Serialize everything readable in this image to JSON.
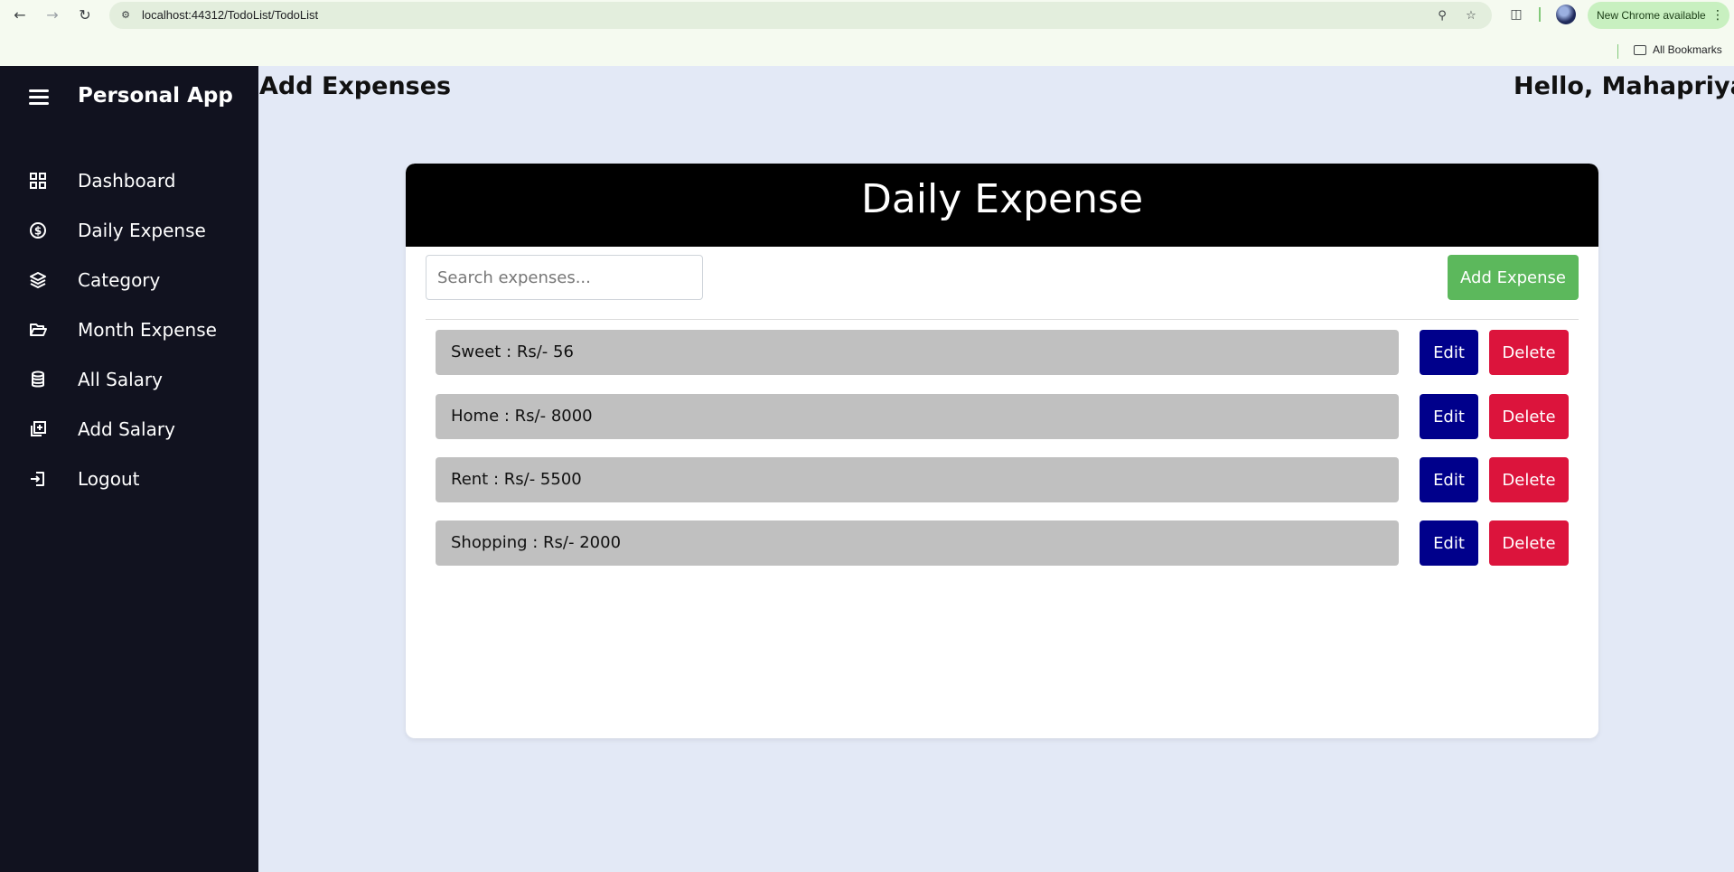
{
  "browser": {
    "url": "localhost:44312/TodoList/TodoList",
    "update_pill": "New Chrome available",
    "bookmarks_label": "All Bookmarks"
  },
  "sidebar": {
    "app_title": "Personal App",
    "items": [
      {
        "label": "Dashboard",
        "icon": "dashboard-grid-icon"
      },
      {
        "label": "Daily Expense",
        "icon": "dollar-circle-icon"
      },
      {
        "label": "Category",
        "icon": "layers-icon"
      },
      {
        "label": "Month Expense",
        "icon": "folder-open-icon"
      },
      {
        "label": "All Salary",
        "icon": "database-icon"
      },
      {
        "label": "Add Salary",
        "icon": "add-square-icon"
      },
      {
        "label": "Logout",
        "icon": "logout-icon"
      }
    ]
  },
  "header": {
    "page_title": "Add Expenses",
    "greeting": "Hello, Mahapriya"
  },
  "card": {
    "title": "Daily Expense",
    "search_placeholder": "Search expenses...",
    "add_button": "Add Expense",
    "edit_label": "Edit",
    "delete_label": "Delete",
    "expenses": [
      {
        "text": "Sweet : Rs/- 56"
      },
      {
        "text": "Home : Rs/- 8000"
      },
      {
        "text": "Rent : Rs/- 5500"
      },
      {
        "text": "Shopping : Rs/- 2000"
      }
    ]
  },
  "colors": {
    "sidebar_bg": "#11121f",
    "page_bg": "#e3e9f6",
    "add_button": "#5cb85c",
    "edit_button": "#00008b",
    "delete_button": "#dc143c",
    "row_bg": "#c0c0c0"
  }
}
